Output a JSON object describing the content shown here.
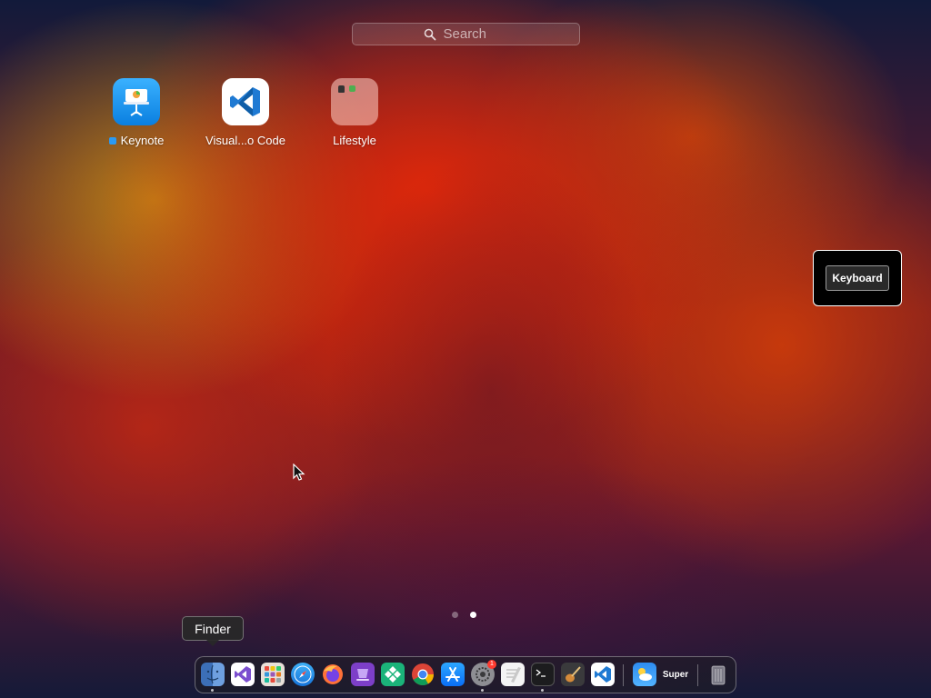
{
  "search": {
    "placeholder": "Search",
    "icon": "magnifier-icon"
  },
  "apps": [
    {
      "label": "Keynote",
      "icon": "keynote-icon",
      "new": true
    },
    {
      "label": "Visual...o Code",
      "icon": "vscode-icon"
    },
    {
      "label": "Lifestyle",
      "icon": "folder-icon"
    }
  ],
  "keyboard_overlay": {
    "key_label": "Keyboard"
  },
  "pagination": {
    "pages": 2,
    "current": 2
  },
  "tooltip": {
    "text": "Finder"
  },
  "dock": {
    "items": [
      {
        "name": "Finder",
        "icon": "finder-icon",
        "running": true
      },
      {
        "name": "Visual Studio",
        "icon": "visual-studio-icon"
      },
      {
        "name": "Launchpad",
        "icon": "launchpad-icon"
      },
      {
        "name": "Safari",
        "icon": "safari-icon"
      },
      {
        "name": "Firefox",
        "icon": "firefox-icon"
      },
      {
        "name": "Purple app",
        "icon": "purple-app-icon"
      },
      {
        "name": "Green app",
        "icon": "green-diamond-app-icon"
      },
      {
        "name": "Chrome",
        "icon": "chrome-icon"
      },
      {
        "name": "App Store",
        "icon": "app-store-icon"
      },
      {
        "name": "System Settings",
        "icon": "system-settings-icon",
        "running": true,
        "badge": "1"
      },
      {
        "name": "TextEdit",
        "icon": "textedit-icon"
      },
      {
        "name": "Terminal",
        "icon": "terminal-icon",
        "running": true
      },
      {
        "name": "Instruments",
        "icon": "guitar-app-icon"
      },
      {
        "name": "VS Code",
        "icon": "vscode-dock-icon"
      },
      {
        "name": "Weather",
        "icon": "weather-icon"
      },
      {
        "name": "Super",
        "icon": "super-app-icon",
        "text": "Super"
      },
      {
        "name": "Trash",
        "icon": "trash-icon"
      }
    ]
  },
  "colors": {
    "keynote": "#1e96f5",
    "vscode": "#1f7ad3",
    "dock_bg": "#1e1e23"
  }
}
